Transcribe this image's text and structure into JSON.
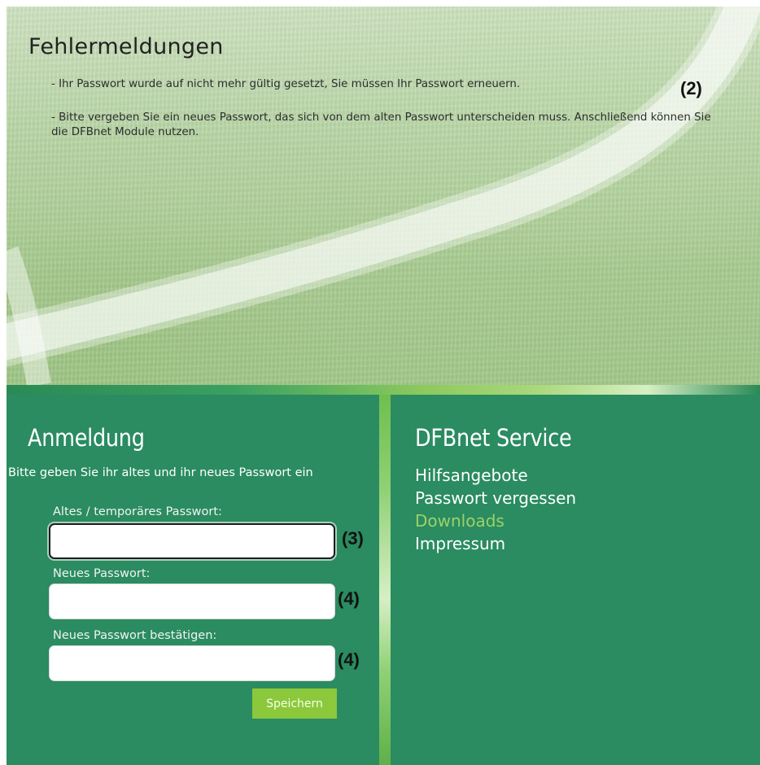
{
  "errors": {
    "title": "Fehlermeldungen",
    "messages": [
      "- Ihr Passwort wurde auf nicht mehr gültig gesetzt, Sie müssen Ihr Passwort erneuern.",
      "- Bitte vergeben Sie ein neues Passwort, das sich von dem alten Passwort unterscheiden muss. Anschließend können Sie die DFBnet Module nutzen."
    ],
    "annotation": "(2)"
  },
  "login": {
    "title": "Anmeldung",
    "intro": "Bitte geben Sie ihr altes und ihr neues Passwort ein",
    "fields": [
      {
        "label": "Altes / temporäres Passwort:",
        "value": "",
        "annotation": "(3)"
      },
      {
        "label": "Neues Passwort:",
        "value": "",
        "annotation": "(4)"
      },
      {
        "label": "Neues Passwort bestätigen:",
        "value": "",
        "annotation": "(4)"
      }
    ],
    "save_label": "Speichern"
  },
  "service": {
    "title": "DFBnet Service",
    "links": [
      {
        "label": "Hilfsangebote",
        "active": false
      },
      {
        "label": "Passwort vergessen",
        "active": false
      },
      {
        "label": "Downloads",
        "active": true
      },
      {
        "label": "Impressum",
        "active": false
      }
    ]
  },
  "colors": {
    "panel_green": "#2a8c60",
    "accent_green": "#8cc83c",
    "link_active": "#9dd16a"
  }
}
